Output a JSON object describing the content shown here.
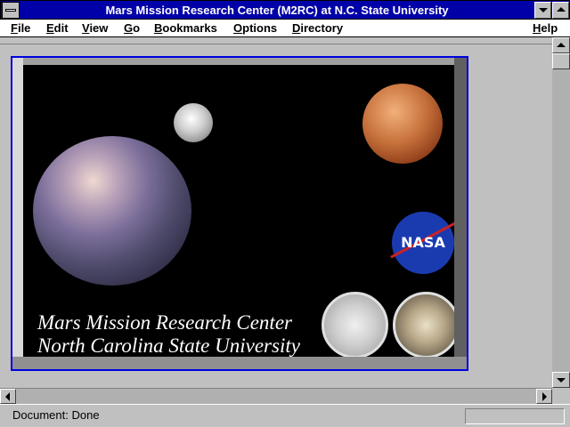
{
  "window": {
    "title": "Mars Mission Research Center (M2RC) at N.C. State University"
  },
  "menu": {
    "left_items": [
      "File",
      "Edit",
      "View",
      "Go",
      "Bookmarks",
      "Options",
      "Directory"
    ],
    "help": "Help"
  },
  "banner": {
    "line1": "Mars Mission Research Center",
    "line2": "North Carolina State University",
    "nasa_logo_text": "NASA"
  },
  "status": {
    "text": "Document: Done"
  },
  "colors": {
    "title_bar": "#0000a8",
    "banner_border": "#0000e0",
    "banner_background": "#000000"
  }
}
